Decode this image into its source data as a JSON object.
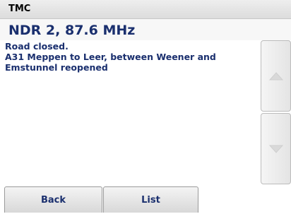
{
  "header": {
    "title": "TMC"
  },
  "station": {
    "name": "NDR 2, 87.6 MHz"
  },
  "message": {
    "lines": [
      "Road closed.",
      "A31 Meppen to Leer, between Weener and",
      "Emstunnel reopened"
    ]
  },
  "scroll": {
    "up_icon": "triangle-up-icon",
    "down_icon": "triangle-down-icon"
  },
  "buttons": {
    "back_label": "Back",
    "list_label": "List"
  }
}
